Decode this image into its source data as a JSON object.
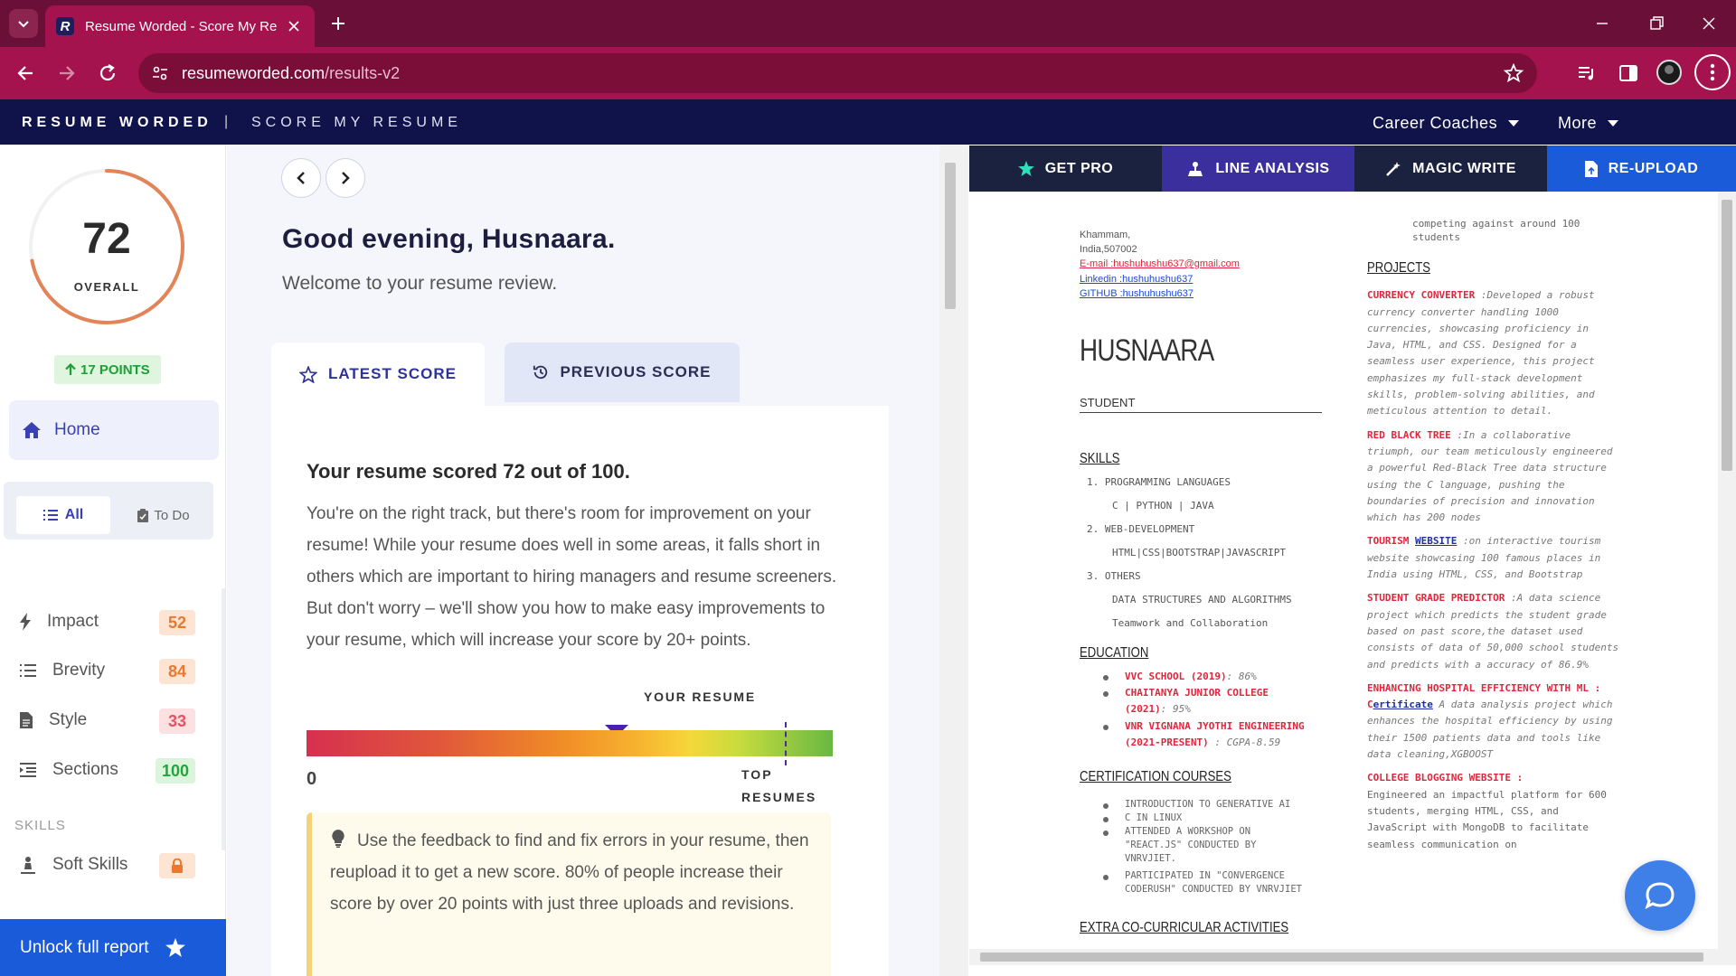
{
  "browser": {
    "tab_title": "Resume Worded - Score My Re",
    "favicon_letter": "R",
    "url_host": "resumeworded.com",
    "url_path": "/results-v2"
  },
  "sitenav": {
    "brand": "RESUME WORDED",
    "separator": "|",
    "subtitle": "SCORE MY RESUME",
    "menu": [
      {
        "label": "Career Coaches"
      },
      {
        "label": "More"
      }
    ]
  },
  "sidebar": {
    "score": "72",
    "score_fraction": 0.72,
    "score_label": "OVERALL",
    "points_badge": "17 POINTS",
    "home_label": "Home",
    "filters": {
      "all": "All",
      "todo": "To Do"
    },
    "categories": [
      {
        "label": "Impact",
        "score": "52",
        "icon": "bolt-icon",
        "status": "orange"
      },
      {
        "label": "Brevity",
        "score": "84",
        "icon": "list-icon",
        "status": "orange"
      },
      {
        "label": "Style",
        "score": "33",
        "icon": "document-icon",
        "status": "red"
      },
      {
        "label": "Sections",
        "score": "100",
        "icon": "indent-icon",
        "status": "green"
      }
    ],
    "skills_heading": "SKILLS",
    "soft_skills_label": "Soft Skills",
    "unlock_label": "Unlock full report",
    "colors": {
      "ring": "#e38358",
      "accent": "#3b3fb5",
      "unlock": "#1a5bd9"
    }
  },
  "main": {
    "greeting": "Good evening, Husnaara.",
    "welcome": "Welcome to your resume review.",
    "tabs": {
      "latest": "LATEST SCORE",
      "previous": "PREVIOUS SCORE"
    },
    "score_headline": "Your resume scored 72 out of 100.",
    "score_description": "You're on the right track, but there's room for improvement on your resume! While your resume does well in some areas, it falls short in others which are important to hiring managers and resume screeners. But don't worry – we'll show you how to make easy improvements to your resume, which will increase your score by 20+ points.",
    "your_resume_label": "YOUR RESUME",
    "bar_min_label": "0",
    "bar_top_label_1": "TOP",
    "bar_top_label_2": "RESUMES",
    "tip_text": "Use the feedback to find and fix errors in your resume, then reupload it to get a new score. 80% of people increase their score by over 20 points with just three uploads and revisions."
  },
  "panel": {
    "tabs": [
      {
        "label": "GET PRO",
        "icon": "star-icon",
        "bg": "#1b2240"
      },
      {
        "label": "LINE ANALYSIS",
        "icon": "analysis-icon",
        "bg": "#3a2f9c"
      },
      {
        "label": "MAGIC WRITE",
        "icon": "magic-wand-icon",
        "bg": "#1b2240"
      },
      {
        "label": "RE-UPLOAD",
        "icon": "file-upload-icon",
        "bg": "#1a5bd9"
      }
    ],
    "resume": {
      "address_1": "Khammam,",
      "address_2": "India,507002",
      "email": "E-mail :hushuhushu637@gmail.com",
      "linkedin": "Linkedin :hushuhushu637",
      "github": "GITHUB :hushuhushu637",
      "name": "HUSNAARA",
      "role": "STUDENT",
      "skills_heading": "SKILLS",
      "skills": [
        {
          "n": "1. PROGRAMMING LANGUAGES",
          "sub": "C | PYTHON | JAVA"
        },
        {
          "n": "2. WEB-DEVELOPMENT",
          "sub": "HTML|CSS|BOOTSTRAP|JAVASCRIPT"
        },
        {
          "n": "3. OTHERS",
          "sub": "DATA STRUCTURES AND ALGORITHMS"
        }
      ],
      "skills_extra": "Teamwork and Collaboration",
      "education_heading": "EDUCATION",
      "education": [
        {
          "name": "VVC SCHOOL (2019)",
          "detail": ": 86%"
        },
        {
          "name": "CHAITANYA JUNIOR COLLEGE (2021)",
          "detail": ": 95%"
        },
        {
          "name": "VNR VIGNANA JYOTHI ENGINEERING (2021-PRESENT)",
          "detail": " : CGPA-8.59"
        }
      ],
      "certification_heading": "CERTIFICATION COURSES",
      "certifications": [
        "INTRODUCTION TO GENERATIVE AI",
        "C IN LINUX",
        "ATTENDED A WORKSHOP ON \"REACT.JS\" CONDUCTED BY VNRVJIET.",
        "PARTICIPATED IN \"CONVERGENCE CODERUSH\" CONDUCTED BY VNRVJIET"
      ],
      "extra_heading": "EXTRA CO-CURRICULAR ACTIVITIES",
      "right_top": "competing against around 100 students",
      "projects_heading": "PROJECTS",
      "projects": [
        {
          "title": "CURRENCY CONVERTER",
          "body": " :Developed a robust currency converter handling 1000 currencies, showcasing proficiency in Java, HTML, and CSS. Designed for a seamless user experience, this project emphasizes my full-stack development skills, problem-solving abilities, and meticulous attention to detail."
        },
        {
          "title": "RED BLACK TREE",
          "body": " :In a collaborative triumph, our team meticulously engineered a powerful Red-Black Tree data structure using the C language, pushing the boundaries of precision and innovation which has 200 nodes"
        },
        {
          "title": "TOURISM ",
          "link": "WEBSITE",
          "body": " :on interactive tourism website showcasing 100 famous places in India using HTML, CSS, and Bootstrap"
        },
        {
          "title": "STUDENT GRADE PREDICTOR",
          "body": " :A data science project which predicts the student grade based on past score,the dataset used consists of data of 50,000 school students and predicts with a accuracy of 86.9%"
        },
        {
          "title": "ENHANCING HOSPITAL EFFICIENCY WITH ML : C",
          "link": "ertificate",
          "body": " A data analysis project which enhances the hospital efficiency by using their 1500 patients data and tools like data cleaning,XGBOOST"
        },
        {
          "title": "COLLEGE BLOGGING WEBSITE :",
          "plain": "Engineered an impactful platform for 600 students, merging HTML, CSS, and JavaScript with MongoDB to facilitate seamless communication on"
        }
      ]
    }
  }
}
